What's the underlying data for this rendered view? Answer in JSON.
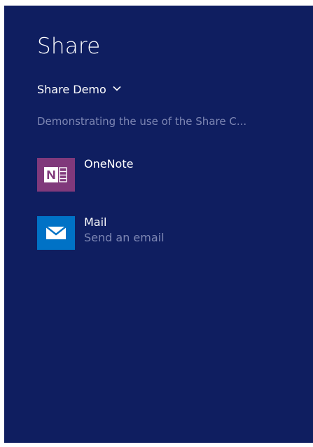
{
  "share": {
    "title": "Share",
    "source_app": "Share Demo",
    "description": "Demonstrating the use of the Share C...",
    "targets": [
      {
        "name": "OneNote",
        "subtitle": "",
        "icon": "onenote-icon",
        "icon_color": "#80397b"
      },
      {
        "name": "Mail",
        "subtitle": "Send an email",
        "icon": "mail-icon",
        "icon_color": "#0072c6"
      }
    ]
  },
  "colors": {
    "pane_background": "#0f1e60",
    "primary_text": "#ffffff",
    "secondary_text": "#7d86b3",
    "page_background": "#ffffff"
  }
}
